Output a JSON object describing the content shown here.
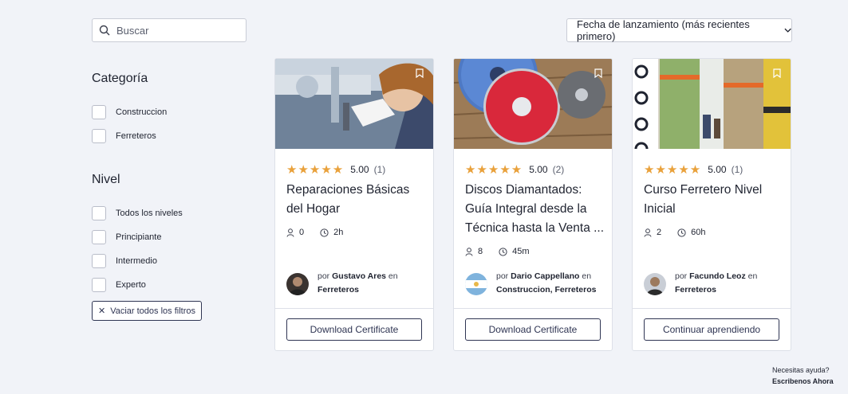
{
  "search": {
    "placeholder": "Buscar"
  },
  "sort": {
    "label": "Fecha de lanzamiento (más recientes primero)"
  },
  "filters": {
    "category": {
      "title": "Categoría",
      "options": [
        "Construccion",
        "Ferreteros"
      ]
    },
    "level": {
      "title": "Nivel",
      "options": [
        "Todos los niveles",
        "Principiante",
        "Intermedio",
        "Experto"
      ]
    },
    "clear_label": "Vaciar todos los filtros"
  },
  "courses": [
    {
      "rating": "5.00",
      "reviews": "(1)",
      "title": "Reparaciones Básicas del Hogar",
      "students": "0",
      "duration": "2h",
      "by": "por",
      "author": "Gustavo Ares",
      "in": "en",
      "categories": "Ferreteros",
      "cta": "Download Certificate"
    },
    {
      "rating": "5.00",
      "reviews": "(2)",
      "title": "Discos Diamantados: Guía Integral desde la Técnica hasta la Venta ...",
      "students": "8",
      "duration": "45m",
      "by": "por",
      "author": "Dario Cappellano",
      "in": "en",
      "categories": "Construccion, Ferreteros",
      "cta": "Download Certificate"
    },
    {
      "rating": "5.00",
      "reviews": "(1)",
      "title": "Curso Ferretero Nivel Inicial",
      "students": "2",
      "duration": "60h",
      "by": "por",
      "author": "Facundo Leoz",
      "in": "en",
      "categories": "Ferreteros",
      "cta": "Continuar aprendiendo"
    }
  ],
  "help": {
    "line1": "Necesitas ayuda?",
    "line2": "Escribenos Ahora"
  },
  "colors": {
    "star": "#e9a13b",
    "accent": "#2f3553",
    "background": "#f1f3f8"
  }
}
